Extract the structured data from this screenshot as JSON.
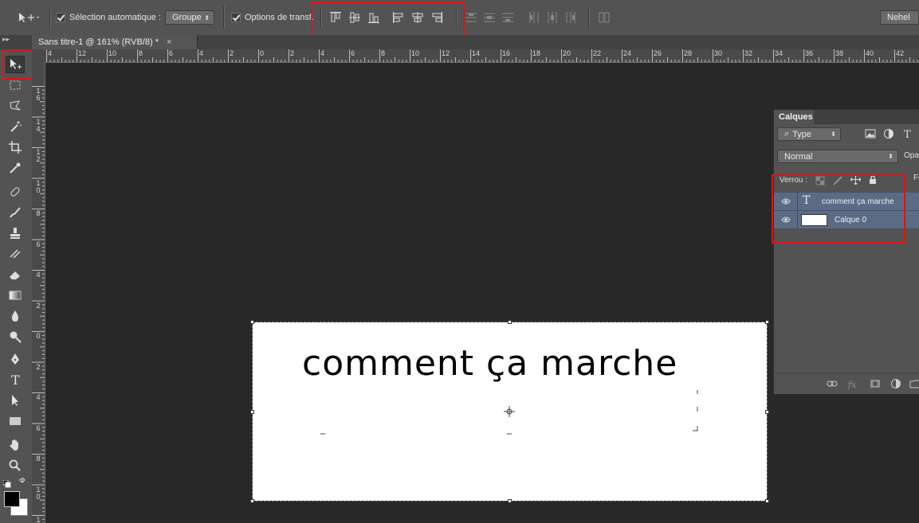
{
  "options_bar": {
    "auto_select_label": "Sélection automatique :",
    "auto_select_value": "Groupe",
    "transform_label": "Options de transf.",
    "workspace": "Nehel"
  },
  "document": {
    "tab_title": "Sans titre-1 @ 161% (RVB/8) *",
    "close": "×"
  },
  "ruler_top": [
    "4",
    "12",
    "10",
    "8",
    "6",
    "4",
    "2",
    "0",
    "2",
    "4",
    "6",
    "8",
    "10",
    "12",
    "14",
    "16",
    "18",
    "20",
    "22",
    "24",
    "26",
    "28",
    "30",
    "32",
    "34",
    "36",
    "38",
    "40",
    "42"
  ],
  "ruler_left": [
    "1\n6",
    "1\n4",
    "1\n2",
    "1\n0",
    "8",
    "6",
    "4",
    "2",
    "0",
    "2",
    "4",
    "6",
    "8",
    "1\n0",
    "1\n2"
  ],
  "canvas": {
    "text": "comment ça marche"
  },
  "layers_panel": {
    "title": "Calques",
    "filter_type": "Type",
    "blend_mode": "Normal",
    "opacity_label": "Opa",
    "lock_label": "Verrou :",
    "fill_label": "Fo",
    "layers": [
      {
        "name": "comment ça marche",
        "kind": "text"
      },
      {
        "name": "Calque 0",
        "kind": "pixel"
      }
    ]
  },
  "colors": {
    "highlight": "#d8161b",
    "selected_layer": "#5b6b83"
  }
}
